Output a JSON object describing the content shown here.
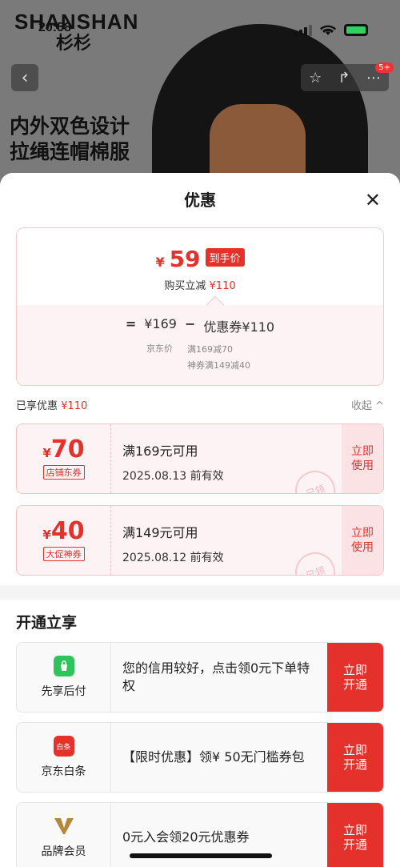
{
  "status_bar": {
    "time": "20:58"
  },
  "background": {
    "brand": "SHANSHAN",
    "brand_sub": "杉杉",
    "headline_line1": "内外双色设计",
    "headline_line2": "拉绳连帽棉服",
    "badge": "5+"
  },
  "sheet": {
    "title": "优惠",
    "price": {
      "yen": "¥",
      "final": "59",
      "tag": "到手价",
      "sub_prefix": "购买立减",
      "sub_amount": "¥110",
      "equals": "=",
      "base": "¥169",
      "minus": "−",
      "coupon_total": "优惠券¥110",
      "base_label": "京东价",
      "coupon_lines": [
        "满169减70",
        "神券满149减40"
      ]
    },
    "enjoyed": {
      "label": "已享优惠",
      "amount": "¥110",
      "fold": "收起 ^"
    },
    "coupons": [
      {
        "yen": "¥",
        "amount": "70",
        "type": "店铺东券",
        "condition": "满169元可用",
        "expiry": "2025.08.13 前有效",
        "action": "立即使用",
        "stamp": "已领"
      },
      {
        "yen": "¥",
        "amount": "40",
        "type": "大促神券",
        "condition": "满149元可用",
        "expiry": "2025.08.12 前有效",
        "action": "立即使用",
        "stamp": "已领"
      }
    ],
    "open_section": {
      "title": "开通立享",
      "items": [
        {
          "name": "先享后付",
          "desc": "您的信用较好，点击领0元下单特权",
          "action": "立即开通"
        },
        {
          "name": "京东白条",
          "icon_text": "白条",
          "desc": "【限时优惠】领¥ 50无门槛券包",
          "action": "立即开通"
        },
        {
          "name": "品牌会员",
          "desc": "0元入会领20元优惠券",
          "action": "立即开通"
        }
      ]
    }
  },
  "colors": {
    "accent": "#e4312b",
    "coupon_bg": "#fdf3f4"
  }
}
